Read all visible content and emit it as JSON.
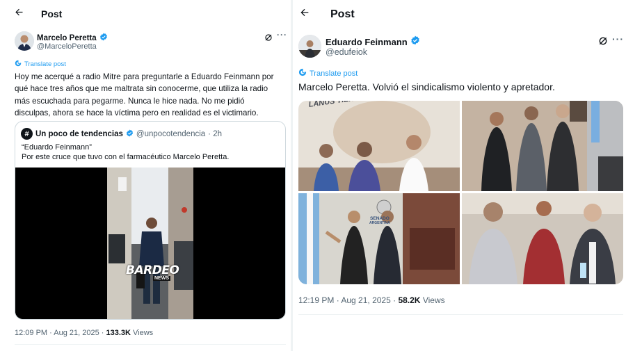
{
  "left_post": {
    "header": {
      "back_icon": "arrow-left-icon",
      "title": "Post"
    },
    "author": {
      "name": "Marcelo Peretta",
      "handle": "@MarceloPeretta",
      "verified_color": "#1d9bf0"
    },
    "translate_label": "Translate post",
    "text_lines": [
      "Hoy me acerqué a radio Mitre para preguntarle a Eduardo Feinmann por",
      "qué hace tres años que me maltrata sin conocerme, que utiliza la radio",
      "más escuchada para pegarme. Nunca le hice nada. No me pidió",
      "disculpas, ahora se hace la víctima pero en realidad es el victimario."
    ],
    "quote": {
      "avatar_glyph": "#",
      "name": "Un poco de tendencias",
      "handle": "@unpocotendencia",
      "time": "· 2h",
      "line1": "“Eduardo Feinmann”",
      "line2": "Por este cruce que tuvo con el farmacéutico Marcelo Peretta.",
      "watermark_main": "BARDEO",
      "watermark_sub": "NEWS"
    },
    "meta": {
      "time": "12:09 PM · Aug 21, 2025 ·",
      "views_count": "133.3K",
      "views_label": "Views"
    }
  },
  "right_post": {
    "header": {
      "back_icon": "arrow-left-icon",
      "title": "Post"
    },
    "author": {
      "name": "Eduardo Feinmann",
      "handle": "@edufeiok",
      "verified_color": "#1d9bf0"
    },
    "translate_label": "Translate post",
    "text": "Marcelo Peretta. Volvió el sindicalismo violento y apretador.",
    "photos": {
      "p1_sign": "LANUS TIENE UN PUEBLO",
      "p3_sign1": "SENADO",
      "p3_sign2": "ARGENTINA"
    },
    "meta": {
      "time": "12:19 PM · Aug 21, 2025 ·",
      "views_count": "58.2K",
      "views_label": "Views"
    }
  },
  "colors": {
    "accent": "#1d9bf0",
    "text": "#0f1419",
    "muted": "#536471",
    "border": "#cfd9de"
  }
}
